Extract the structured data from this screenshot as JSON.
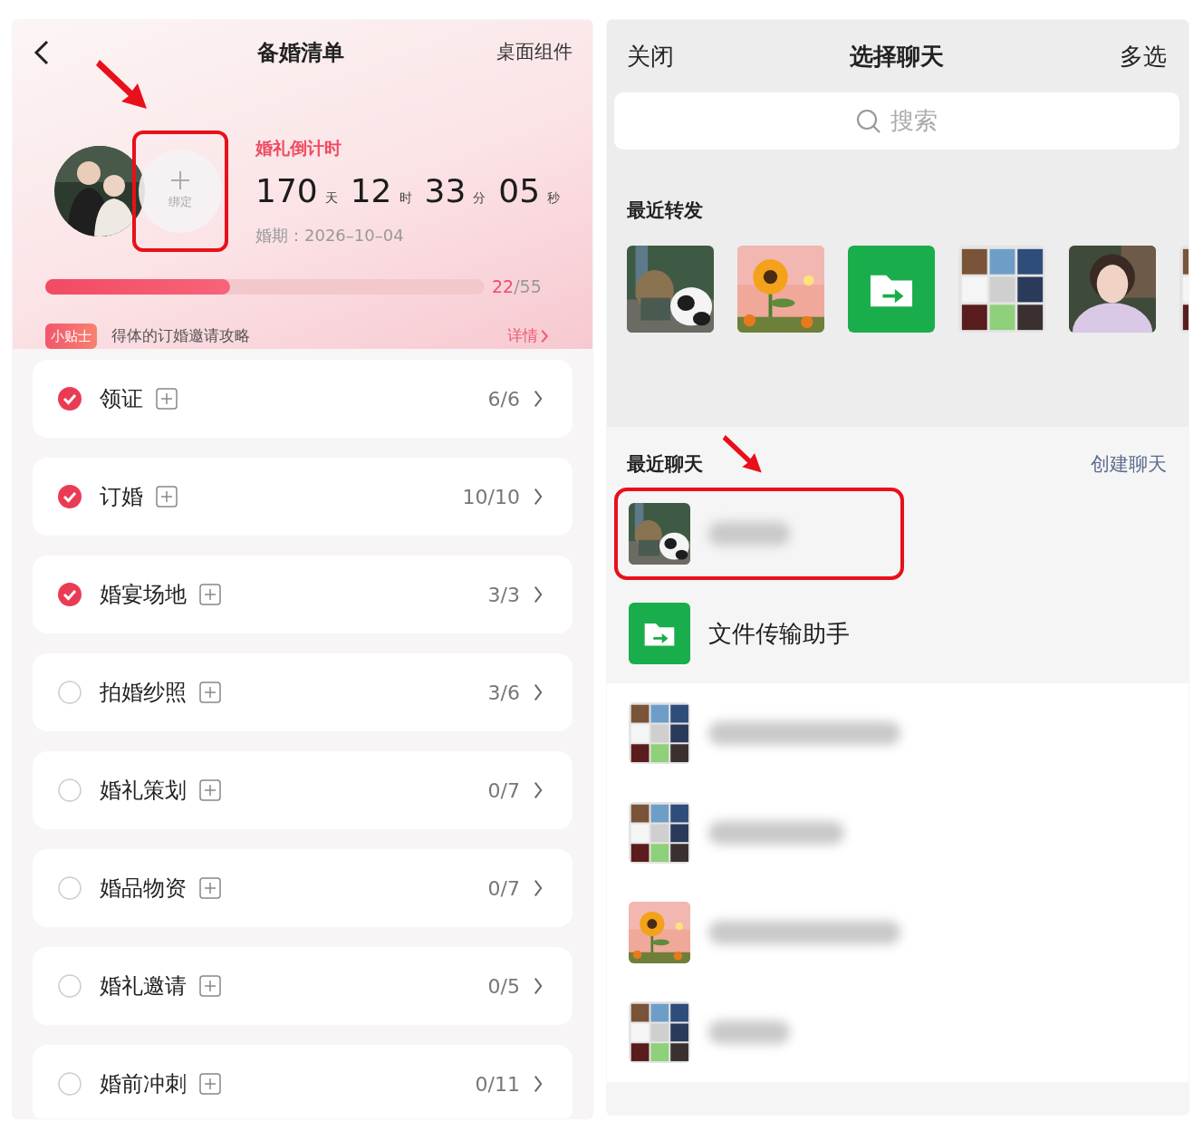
{
  "left": {
    "title": "备婚清单",
    "action": "桌面组件",
    "bind": {
      "label": "绑定",
      "highlighted": true
    },
    "countdown_title": "婚礼倒计时",
    "countdown": [
      {
        "value": "170",
        "unit": "天"
      },
      {
        "value": "12",
        "unit": "时"
      },
      {
        "value": "33",
        "unit": "分"
      },
      {
        "value": "05",
        "unit": "秒"
      }
    ],
    "date": "婚期：2026–10–04",
    "progress": {
      "level": 0.42,
      "done": "22",
      "total": "/55"
    },
    "tip": {
      "badge": "小贴士",
      "text": "得体的订婚邀请攻略",
      "link": "详情"
    },
    "tasks": [
      {
        "name": "领证",
        "count": "6/6",
        "checked": true
      },
      {
        "name": "订婚",
        "count": "10/10",
        "checked": true
      },
      {
        "name": "婚宴场地",
        "count": "3/3",
        "checked": true
      },
      {
        "name": "拍婚纱照",
        "count": "3/6",
        "checked": false
      },
      {
        "name": "婚礼策划",
        "count": "0/7",
        "checked": false
      },
      {
        "name": "婚品物资",
        "count": "0/7",
        "checked": false
      },
      {
        "name": "婚礼邀请",
        "count": "0/5",
        "checked": false
      },
      {
        "name": "婚前冲刺",
        "count": "0/11",
        "checked": false
      }
    ]
  },
  "right": {
    "close": "关闭",
    "title": "选择聊天",
    "multi": "多选",
    "search": {
      "placeholder": "搜索"
    },
    "forward_title": "最近转发",
    "forward": [
      {
        "kind": "picture"
      },
      {
        "kind": "picture"
      },
      {
        "kind": "file"
      },
      {
        "kind": "picture"
      },
      {
        "kind": "picture"
      },
      {
        "kind": "picture"
      }
    ],
    "chats_title": "最近聊天",
    "create": "创建聊天",
    "chats": [
      {
        "kind": "picture",
        "highlighted": true
      },
      {
        "kind": "file",
        "name": "文件传输助手",
        "highlighted": false
      },
      {
        "kind": "picture",
        "highlighted": false
      },
      {
        "kind": "picture",
        "highlighted": false
      },
      {
        "kind": "picture",
        "highlighted": false
      },
      {
        "kind": "picture",
        "highlighted": false
      }
    ]
  }
}
